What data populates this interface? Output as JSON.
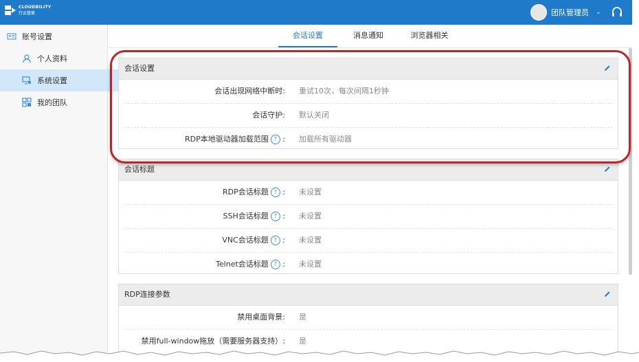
{
  "brand": {
    "logo_en": "CLOUDBILITY",
    "logo_cn": "行云管家"
  },
  "user": {
    "name": "团队管理员"
  },
  "sidebar": {
    "header": "账号设置",
    "items": [
      {
        "label": "个人资料"
      },
      {
        "label": "系统设置"
      },
      {
        "label": "我的团队"
      }
    ]
  },
  "tabs": [
    {
      "label": "会话设置"
    },
    {
      "label": "消息通知"
    },
    {
      "label": "浏览器相关"
    }
  ],
  "sections": [
    {
      "title": "会话设置",
      "rows": [
        {
          "label": "会话出现网络中断时:",
          "value": "重试10次，每次间隔1秒钟"
        },
        {
          "label": "会话守护:",
          "value": "默认关闭"
        },
        {
          "label": "RDP本地驱动器加载范围",
          "value": "加载所有驱动器"
        }
      ]
    },
    {
      "title": "会话标题",
      "rows": [
        {
          "label": "RDP会话标题",
          "value": "未设置"
        },
        {
          "label": "SSH会话标题",
          "value": "未设置"
        },
        {
          "label": "VNC会话标题",
          "value": "未设置"
        },
        {
          "label": "Telnet会话标题",
          "value": "未设置"
        }
      ]
    },
    {
      "title": "RDP连接参数",
      "rows": [
        {
          "label": "禁用桌面背景:",
          "value": "是"
        },
        {
          "label": "禁用full-window拖放（需要服务器支持）:",
          "value": "是"
        }
      ]
    }
  ],
  "help_glyph": "?",
  "colon": ":",
  "colors": {
    "topbar": "#1f7ac9",
    "active_tab": "#1f7ac9",
    "sidebar_active": "#d3e7fa",
    "highlight": "#b8262a"
  }
}
